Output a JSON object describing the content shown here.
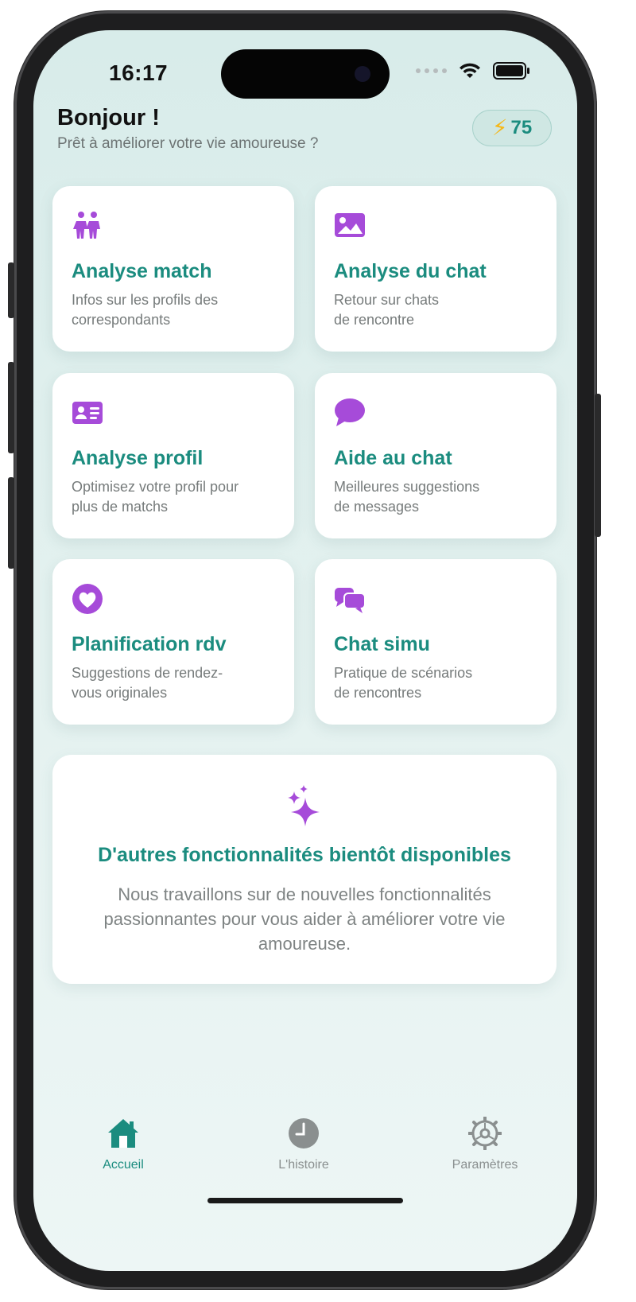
{
  "status_bar": {
    "time": "16:17",
    "icons": [
      "cellular-dots",
      "wifi-icon",
      "battery-icon"
    ]
  },
  "header": {
    "title": "Bonjour !",
    "subtitle": "Prêt à améliorer votre vie amoureuse ?"
  },
  "credits": {
    "icon": "lightning-bolt",
    "value": "75"
  },
  "cards": [
    {
      "icon": "couple-icon",
      "title": "Analyse match",
      "description": "Infos sur les profils des\ncorrespondants"
    },
    {
      "icon": "image-icon",
      "title": "Analyse du chat",
      "description": "Retour sur chats\nde rencontre"
    },
    {
      "icon": "id-card-icon",
      "title": "Analyse profil",
      "description": "Optimisez votre profil pour\nplus de matchs"
    },
    {
      "icon": "speech-bubble-icon",
      "title": "Aide au chat",
      "description": "Meilleures suggestions\nde messages"
    },
    {
      "icon": "heart-circle-icon",
      "title": "Planification rdv",
      "description": "Suggestions de rendez-\nvous originales"
    },
    {
      "icon": "chat-bubbles-icon",
      "title": "Chat simu",
      "description": "Pratique de scénarios\nde rencontres"
    }
  ],
  "banner": {
    "icon": "sparkles-icon",
    "title": "D'autres fonctionnalités bientôt disponibles",
    "body": "Nous travaillons sur de nouvelles fonctionnalités passionnantes pour vous aider à améliorer votre vie amoureuse."
  },
  "tabs": [
    {
      "label": "Accueil",
      "icon": "home-icon",
      "active": true
    },
    {
      "label": "L'histoire",
      "icon": "clock-icon",
      "active": false
    },
    {
      "label": "Paramètres",
      "icon": "gear-icon",
      "active": false
    }
  ],
  "colors": {
    "accent": "#1b8c7f",
    "icon_purple": "#a64bd9",
    "background": "#dcefec"
  }
}
